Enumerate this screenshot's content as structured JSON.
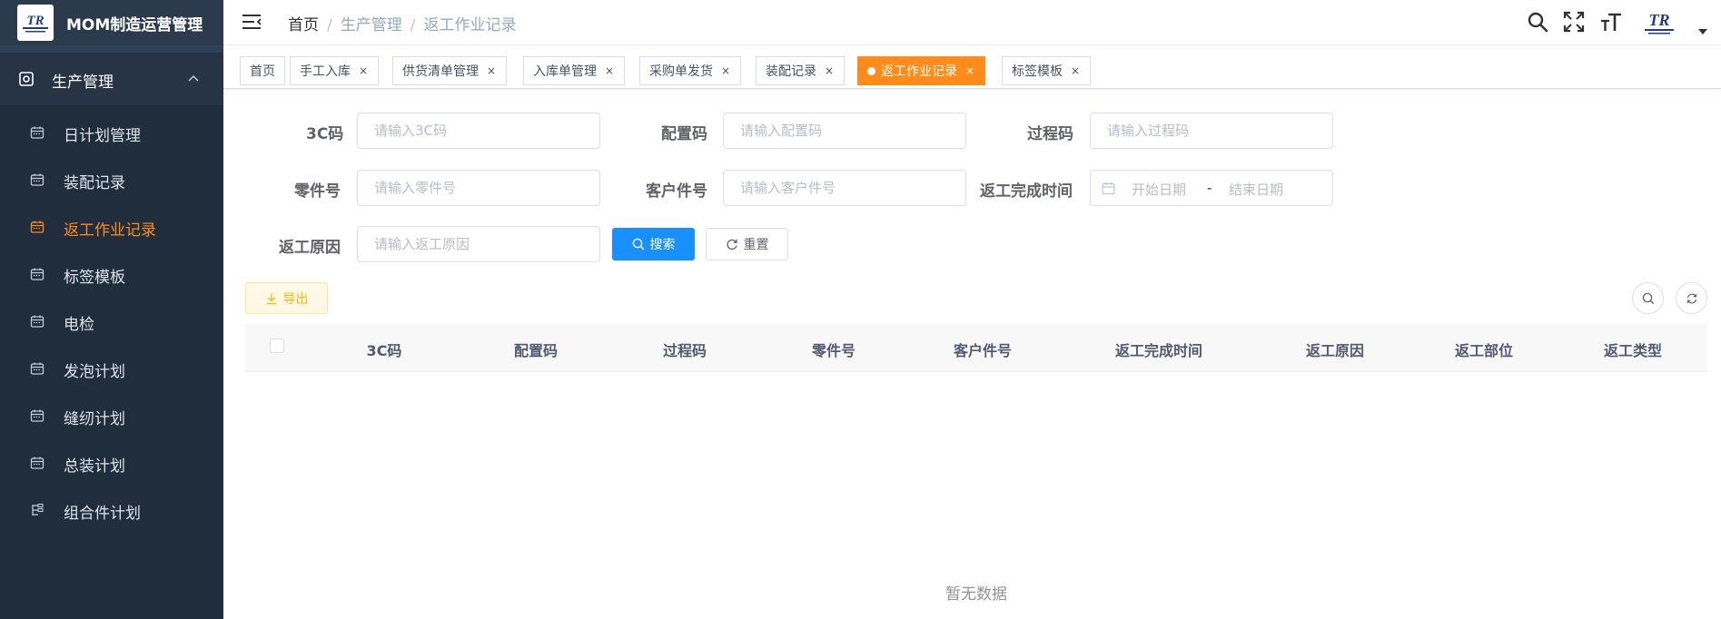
{
  "app": {
    "title": "MOM制造运营管理",
    "logo_text": "TR"
  },
  "sidebar": {
    "parent": {
      "label": "生产管理"
    },
    "items": [
      {
        "label": "日计划管理",
        "active": false
      },
      {
        "label": "装配记录",
        "active": false
      },
      {
        "label": "返工作业记录",
        "active": true
      },
      {
        "label": "标签模板",
        "active": false
      },
      {
        "label": "电检",
        "active": false
      },
      {
        "label": "发泡计划",
        "active": false
      },
      {
        "label": "缝纫计划",
        "active": false
      },
      {
        "label": "总装计划",
        "active": false
      },
      {
        "label": "组合件计划",
        "active": false
      }
    ]
  },
  "breadcrumb": {
    "items": [
      "首页",
      "生产管理",
      "返工作业记录"
    ],
    "separator": "/"
  },
  "tabs": [
    {
      "label": "首页",
      "closable": false,
      "active": false
    },
    {
      "label": "手工入库",
      "closable": true,
      "active": false
    },
    {
      "label": "供货清单管理",
      "closable": true,
      "active": false
    },
    {
      "label": "入库单管理",
      "closable": true,
      "active": false
    },
    {
      "label": "采购单发货",
      "closable": true,
      "active": false
    },
    {
      "label": "装配记录",
      "closable": true,
      "active": false
    },
    {
      "label": "返工作业记录",
      "closable": true,
      "active": true
    },
    {
      "label": "标签模板",
      "closable": true,
      "active": false
    }
  ],
  "tab_close_glyph": "×",
  "filters": {
    "code3c": {
      "label": "3C码",
      "placeholder": "请输入3C码"
    },
    "config_code": {
      "label": "配置码",
      "placeholder": "请输入配置码"
    },
    "process_code": {
      "label": "过程码",
      "placeholder": "请输入过程码"
    },
    "part_no": {
      "label": "零件号",
      "placeholder": "请输入零件号"
    },
    "customer_part_no": {
      "label": "客户件号",
      "placeholder": "请输入客户件号"
    },
    "rework_time": {
      "label": "返工完成时间",
      "start_placeholder": "开始日期",
      "separator": "-",
      "end_placeholder": "结束日期"
    },
    "rework_reason": {
      "label": "返工原因",
      "placeholder": "请输入返工原因"
    }
  },
  "buttons": {
    "search": "搜索",
    "reset": "重置",
    "export": "导出"
  },
  "table": {
    "columns": [
      "3C码",
      "配置码",
      "过程码",
      "零件号",
      "客户件号",
      "返工完成时间",
      "返工原因",
      "返工部位",
      "返工类型"
    ],
    "rows": [],
    "empty_text": "暂无数据"
  },
  "colors": {
    "sidebar_bg": "#304156",
    "active_menu": "#ff8c1a",
    "active_tab": "#ff8c1a",
    "primary": "#1890ff",
    "warning": "#ffba00"
  }
}
